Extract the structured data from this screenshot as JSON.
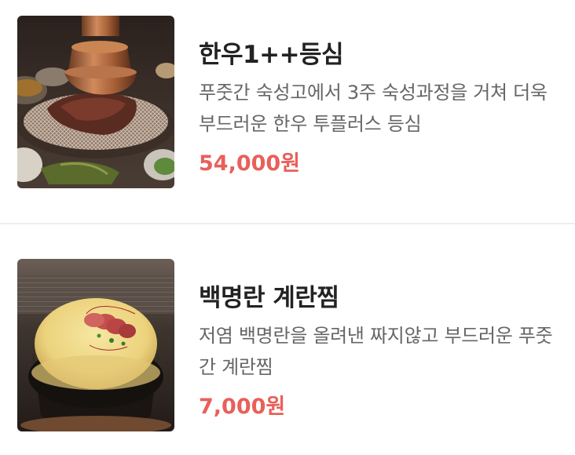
{
  "menu": {
    "items": [
      {
        "name": "한우1++등심",
        "description": "푸줏간 숙성고에서 3주 숙성과정을 거쳐 더욱 부드러운 한우 투플러스 등심",
        "price": "54,000원",
        "image": "grilled-beef-sirloin-photo"
      },
      {
        "name": "백명란 계란찜",
        "description": "저염 백명란을 올려낸 짜지않고 부드러운 푸줏간 계란찜",
        "price": "7,000원",
        "image": "steamed-egg-with-pollock-roe-photo"
      }
    ]
  },
  "colors": {
    "title": "#222222",
    "description": "#666666",
    "price": "#e8605a",
    "divider": "#eeeeee"
  }
}
